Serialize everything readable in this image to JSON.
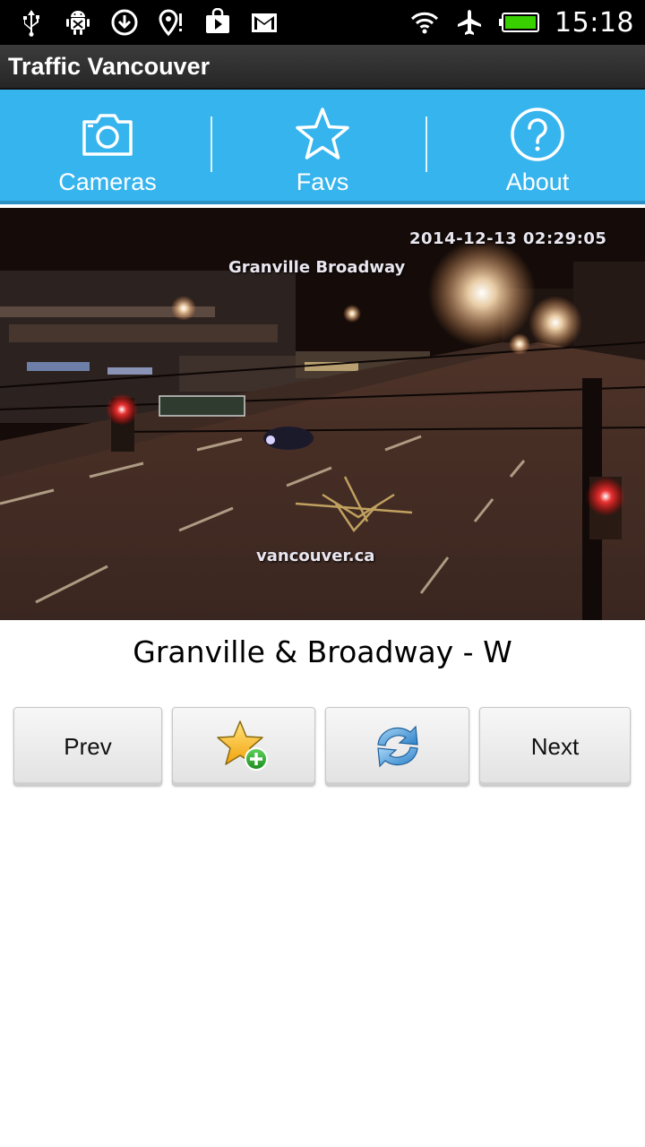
{
  "status_bar": {
    "time": "15:18",
    "left_icons": [
      "usb-icon",
      "android-debug-icon",
      "download-icon",
      "location-alert-icon",
      "play-store-icon",
      "gmail-icon"
    ],
    "right_icons": [
      "wifi-icon",
      "airplane-mode-icon",
      "battery-icon"
    ]
  },
  "app": {
    "title": "Traffic Vancouver"
  },
  "nav": {
    "items": [
      {
        "label": "Cameras",
        "icon": "camera-icon"
      },
      {
        "label": "Favs",
        "icon": "star-icon"
      },
      {
        "label": "About",
        "icon": "help-icon"
      }
    ]
  },
  "camera": {
    "overlay_timestamp": "2014-12-13 02:29:05",
    "overlay_location": "Granville Broadway",
    "overlay_watermark": "vancouver.ca",
    "name": "Granville & Broadway - W"
  },
  "buttons": {
    "prev_label": "Prev",
    "add_fav_icon": "add-favourite-icon",
    "refresh_icon": "refresh-icon",
    "next_label": "Next"
  },
  "colors": {
    "nav_background": "#36b4ee",
    "title_bar": "#2e2e2e",
    "status_bar": "#000000"
  }
}
